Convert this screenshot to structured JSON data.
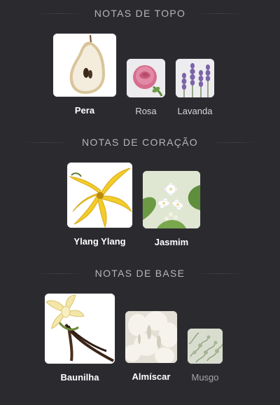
{
  "sections": [
    {
      "title": "NOTAS DE TOPO",
      "notes": [
        {
          "label": "Pera",
          "icon": "pear-icon"
        },
        {
          "label": "Rosa",
          "icon": "rose-icon"
        },
        {
          "label": "Lavanda",
          "icon": "lavender-icon"
        }
      ]
    },
    {
      "title": "NOTAS DE CORAÇÃO",
      "notes": [
        {
          "label": "Ylang Ylang",
          "icon": "ylang-ylang-icon"
        },
        {
          "label": "Jasmim",
          "icon": "jasmine-icon"
        }
      ]
    },
    {
      "title": "NOTAS DE BASE",
      "notes": [
        {
          "label": "Baunilha",
          "icon": "vanilla-icon"
        },
        {
          "label": "Almíscar",
          "icon": "musk-icon"
        },
        {
          "label": "Musgo",
          "icon": "moss-icon"
        }
      ]
    }
  ],
  "colors": {
    "background": "#2b2a2f",
    "title": "#b7b6bb",
    "label": "#ffffff"
  }
}
